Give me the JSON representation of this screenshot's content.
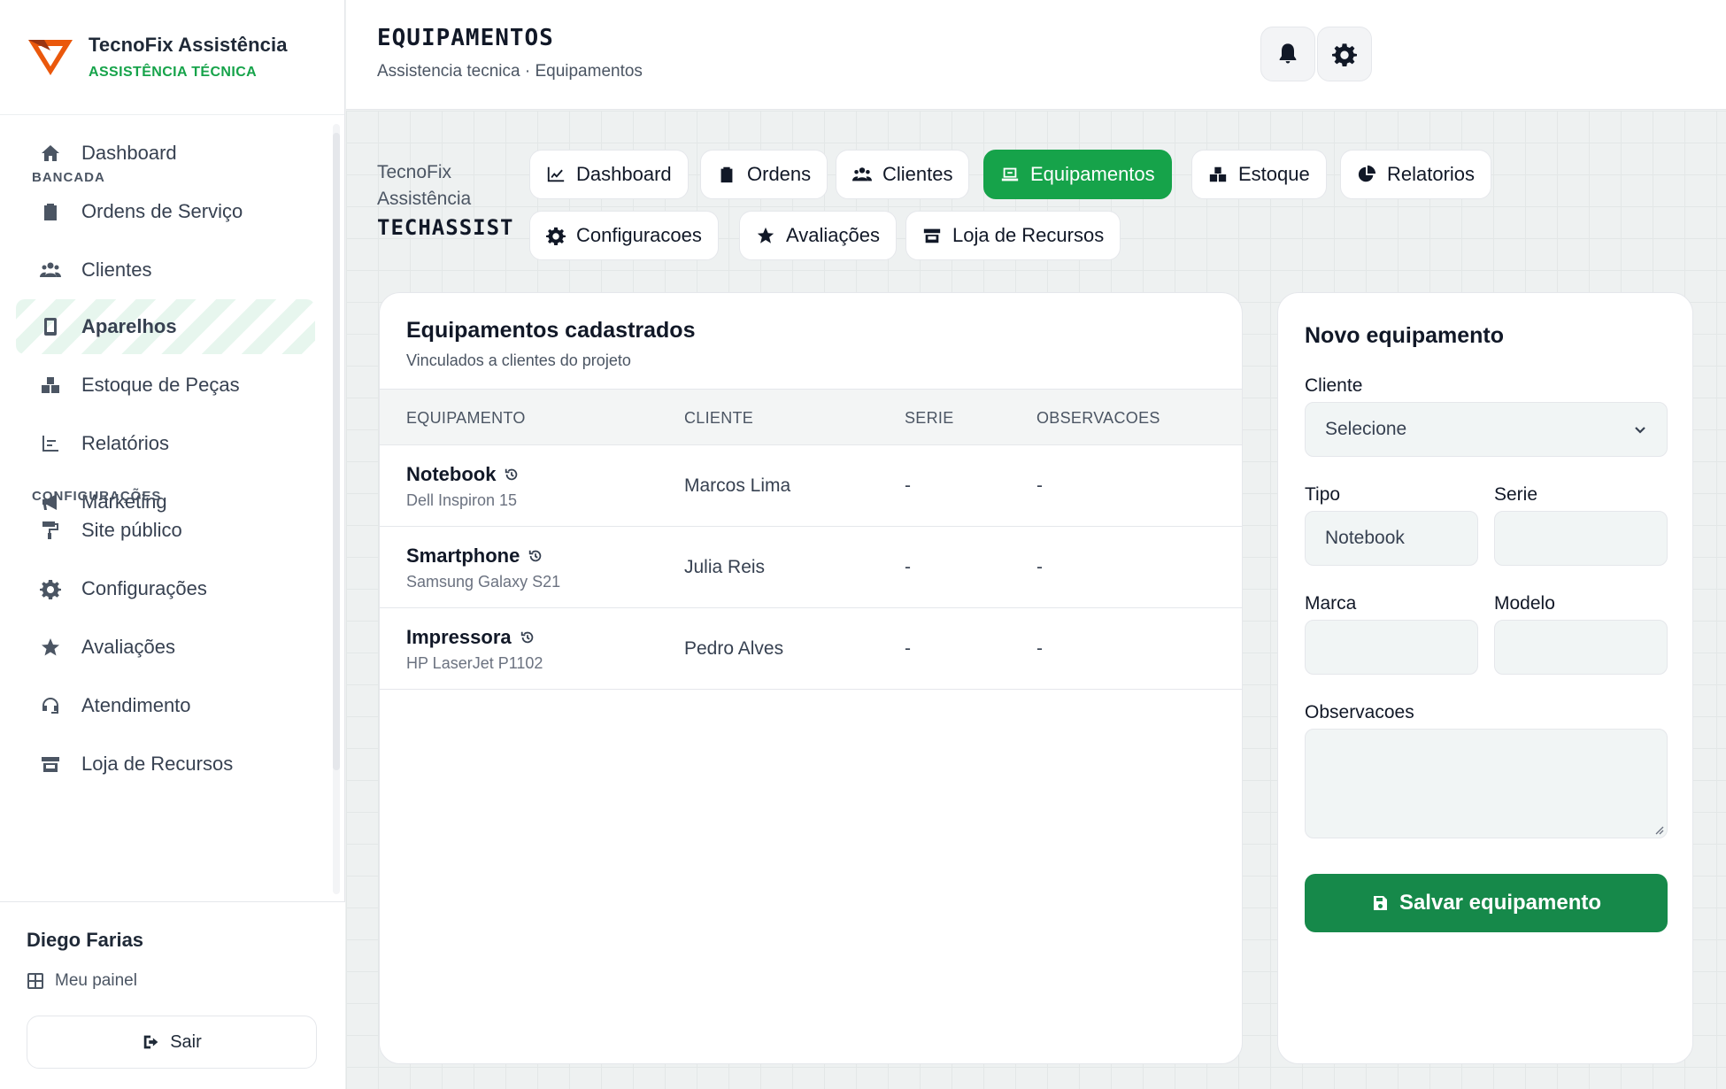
{
  "brand": {
    "name": "TecnoFix Assistência",
    "subtitle": "ASSISTÊNCIA TÉCNICA",
    "color": "#16a34a"
  },
  "sidebar": {
    "items": [
      {
        "label": "Dashboard",
        "icon": "home-icon"
      },
      {
        "label": "Ordens de Serviço",
        "icon": "clipboard-icon"
      },
      {
        "label": "Clientes",
        "icon": "users-icon"
      },
      {
        "label": "Aparelhos",
        "icon": "mobile-icon",
        "active": true
      },
      {
        "label": "Estoque de Peças",
        "icon": "boxes-icon"
      },
      {
        "label": "Relatórios",
        "icon": "chart-icon"
      },
      {
        "label": "Marketing",
        "icon": "megaphone-icon"
      },
      {
        "label": "Site público",
        "icon": "paint-roller-icon"
      },
      {
        "label": "Configurações",
        "icon": "gear-icon"
      },
      {
        "label": "Avaliações",
        "icon": "star-icon"
      },
      {
        "label": "Atendimento",
        "icon": "headset-icon"
      },
      {
        "label": "Loja de Recursos",
        "icon": "store-icon"
      }
    ],
    "sections": {
      "bancada": "BANCADA",
      "configuracoes": "CONFIGURAÇÕES"
    }
  },
  "user": {
    "name": "Diego Farias",
    "panel_link": "Meu painel",
    "logout": "Sair"
  },
  "header": {
    "title": "EQUIPAMENTOS",
    "breadcrumb": "Assistencia tecnica · Equipamentos"
  },
  "org": {
    "name": "TecnoFix Assistência",
    "code": "TECHASSIST"
  },
  "tabs": [
    {
      "label": "Dashboard",
      "icon": "chart-line-icon"
    },
    {
      "label": "Ordens",
      "icon": "clipboard-icon"
    },
    {
      "label": "Clientes",
      "icon": "users-icon"
    },
    {
      "label": "Equipamentos",
      "icon": "laptop-icon",
      "active": true
    },
    {
      "label": "Estoque",
      "icon": "boxes-icon"
    },
    {
      "label": "Relatorios",
      "icon": "pie-chart-icon"
    },
    {
      "label": "Configuracoes",
      "icon": "gear-icon"
    },
    {
      "label": "Avaliações",
      "icon": "star-icon"
    },
    {
      "label": "Loja de Recursos",
      "icon": "store-icon"
    }
  ],
  "list": {
    "title": "Equipamentos cadastrados",
    "subtitle": "Vinculados a clientes do projeto",
    "columns": [
      "EQUIPAMENTO",
      "CLIENTE",
      "SERIE",
      "OBSERVACOES"
    ],
    "rows": [
      {
        "name": "Notebook",
        "model": "Dell Inspiron 15",
        "client": "Marcos Lima",
        "serial": "-",
        "notes": "-"
      },
      {
        "name": "Smartphone",
        "model": "Samsung Galaxy S21",
        "client": "Julia Reis",
        "serial": "-",
        "notes": "-"
      },
      {
        "name": "Impressora",
        "model": "HP LaserJet P1102",
        "client": "Pedro Alves",
        "serial": "-",
        "notes": "-"
      }
    ]
  },
  "form": {
    "title": "Novo equipamento",
    "client_label": "Cliente",
    "client_value": "Selecione",
    "type_label": "Tipo",
    "type_value": "Notebook",
    "serial_label": "Serie",
    "serial_value": "",
    "brand_label": "Marca",
    "brand_value": "",
    "model_label": "Modelo",
    "model_value": "",
    "notes_label": "Observacoes",
    "notes_value": "",
    "save_label": "Salvar equipamento"
  }
}
